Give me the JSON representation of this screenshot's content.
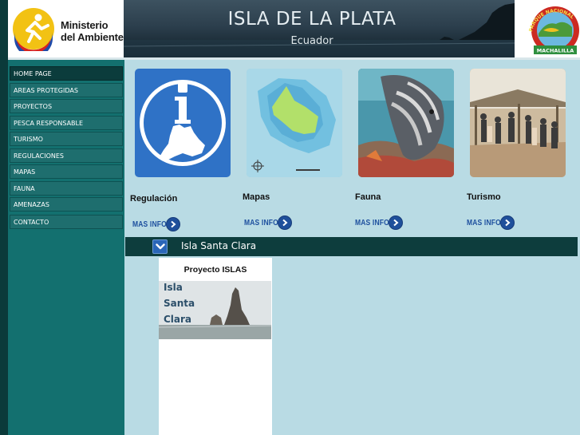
{
  "header": {
    "logo": {
      "line1": "Ministerio",
      "line2": "del Ambiente"
    },
    "banner": {
      "title": "ISLA DE LA PLATA",
      "subtitle": "Ecuador"
    },
    "emblem": {
      "arc_text": "PARQUE NACIONAL",
      "bottom_text": "MACHALILLA"
    }
  },
  "sidebar": {
    "items": [
      {
        "label": "HOME PAGE",
        "active": true
      },
      {
        "label": "AREAS PROTEGIDAS"
      },
      {
        "label": "PROYECTOS"
      },
      {
        "label": "PESCA RESPONSABLE"
      },
      {
        "label": "TURISMO"
      },
      {
        "label": "REGULACIONES"
      },
      {
        "label": "MAPAS"
      },
      {
        "label": "FAUNA"
      },
      {
        "label": "AMENAZAS"
      },
      {
        "label": "CONTACTO"
      }
    ]
  },
  "cards": [
    {
      "title": "Regulación",
      "more_label": "MAS INFO",
      "icon": "info-map-icon"
    },
    {
      "title": "Mapas",
      "more_label": "MAS INFO",
      "icon": "island-map"
    },
    {
      "title": "Fauna",
      "more_label": "MAS INFO",
      "icon": "angelfish-photo"
    },
    {
      "title": "Turismo",
      "more_label": "MAS INFO",
      "icon": "tourists-photo"
    }
  ],
  "section": {
    "title": "Isla Santa Clara",
    "toggle_icon": "chevron-down-icon"
  },
  "project": {
    "title": "Proyecto ISLAS",
    "image_text": [
      "Isla",
      "Santa",
      "Clara"
    ]
  },
  "colors": {
    "page_bg": "#b9dbe4",
    "sidebar": "#13706f",
    "sidebar_active": "#0b3c3c",
    "section_bar": "#0d3d3d",
    "accent_blue": "#1f4f9b"
  }
}
